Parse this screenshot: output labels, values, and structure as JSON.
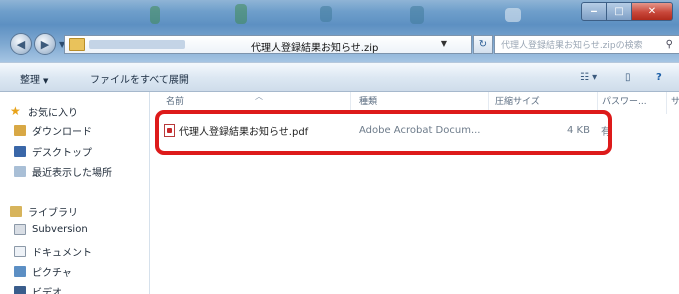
{
  "window": {
    "address": "代理人登録結果お知らせ.zip",
    "search_placeholder": "代理人登録結果お知らせ.zipの検索"
  },
  "commandbar": {
    "organize": "整理",
    "extract_all": "ファイルをすべて展開"
  },
  "navpane": {
    "favorites": "お気に入り",
    "downloads": "ダウンロード",
    "desktop": "デスクトップ",
    "recent": "最近表示した場所",
    "libraries": "ライブラリ",
    "subversion": "Subversion",
    "documents": "ドキュメント",
    "pictures": "ピクチャ",
    "videos": "ビデオ"
  },
  "columns": {
    "name": "名前",
    "type": "種類",
    "compressed_size": "圧縮サイズ",
    "password": "パスワー...",
    "extra": "サ"
  },
  "files": [
    {
      "name": "代理人登録結果お知らせ.pdf",
      "type": "Adobe Acrobat Docum...",
      "size": "4 KB",
      "password": "有"
    }
  ],
  "colors": {
    "highlight": "#dd1a1a",
    "glass": "#6f9fcb"
  }
}
